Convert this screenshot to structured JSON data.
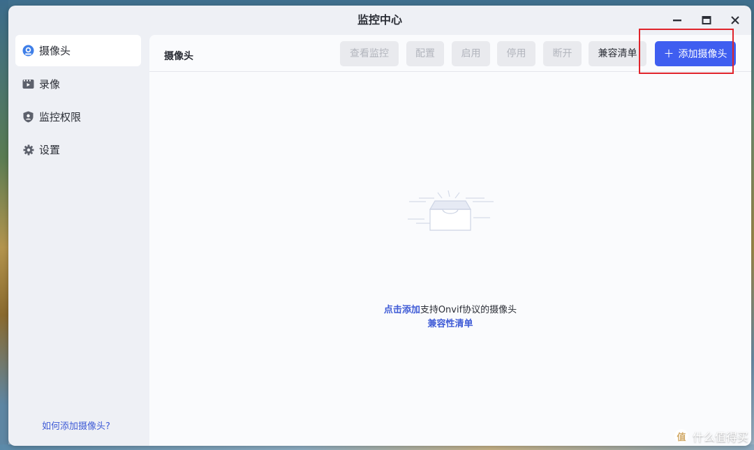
{
  "window": {
    "title": "监控中心",
    "controls": [
      "minimize-icon",
      "maximize-icon",
      "close-icon"
    ]
  },
  "sidebar": {
    "items": [
      {
        "label": "摄像头",
        "icon": "camera-icon",
        "active": true
      },
      {
        "label": "录像",
        "icon": "video-icon",
        "active": false
      },
      {
        "label": "监控权限",
        "icon": "shield-user-icon",
        "active": false
      },
      {
        "label": "设置",
        "icon": "gear-icon",
        "active": false
      }
    ],
    "help_link": "如何添加摄像头?"
  },
  "main": {
    "title": "摄像头",
    "toolbar": {
      "view_monitor": "查看监控",
      "configure": "配置",
      "enable": "启用",
      "disable": "停用",
      "disconnect": "断开",
      "compat_list": "兼容清单",
      "add_camera_icon": "＋",
      "add_camera": "添加摄像头"
    },
    "empty_state": {
      "icon": "empty-inbox-icon",
      "link_text": "点击添加",
      "text": "支持Onvif协议的摄像头",
      "compat_link": "兼容性清单"
    }
  },
  "watermark": {
    "logo": "值",
    "text": "什么值得买"
  },
  "colors": {
    "accent": "#3f5ef0",
    "link": "#3f5bd6",
    "highlight": "#e0242b",
    "window_bg": "#eef0f5",
    "content_bg": "#fafbfd"
  }
}
